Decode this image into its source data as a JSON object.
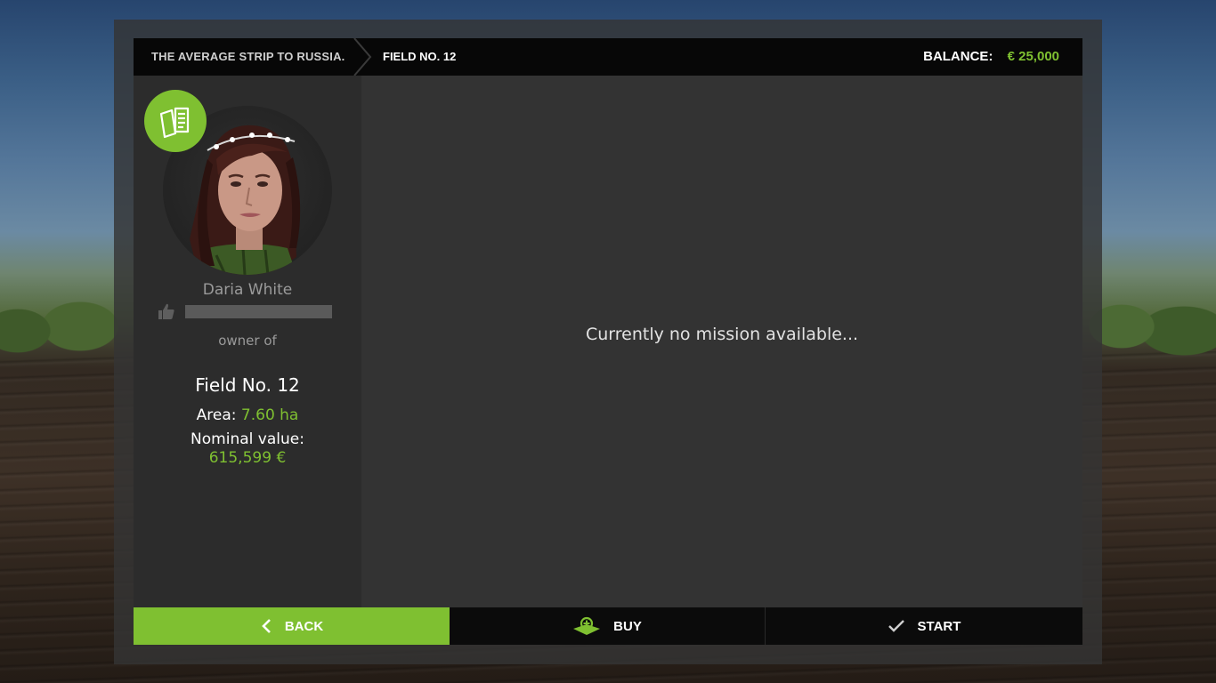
{
  "header": {
    "breadcrumb_1": "THE AVERAGE STRIP TO RUSSIA.",
    "breadcrumb_2": "FIELD NO. 12",
    "balance_label": "BALANCE:",
    "balance_value": "€ 25,000"
  },
  "owner": {
    "name": "Daria White",
    "rating_fraction": 0.0,
    "owner_of_label": "owner of",
    "badge_icon": "contract-documents-icon",
    "portrait_icon": "farmer-portrait"
  },
  "field": {
    "name": "Field No. 12",
    "area_label": "Area:",
    "area_value": "7.60 ha",
    "nominal_label": "Nominal value:",
    "nominal_value": "615,599 €"
  },
  "main": {
    "message": "Currently no mission available..."
  },
  "footer": {
    "back_label": "BACK",
    "buy_label": "BUY",
    "start_label": "START"
  },
  "colors": {
    "accent": "#7fc031",
    "header_bg": "#070707",
    "panel_bg": "#333333",
    "sidebar_bg": "#2c2c2c"
  }
}
